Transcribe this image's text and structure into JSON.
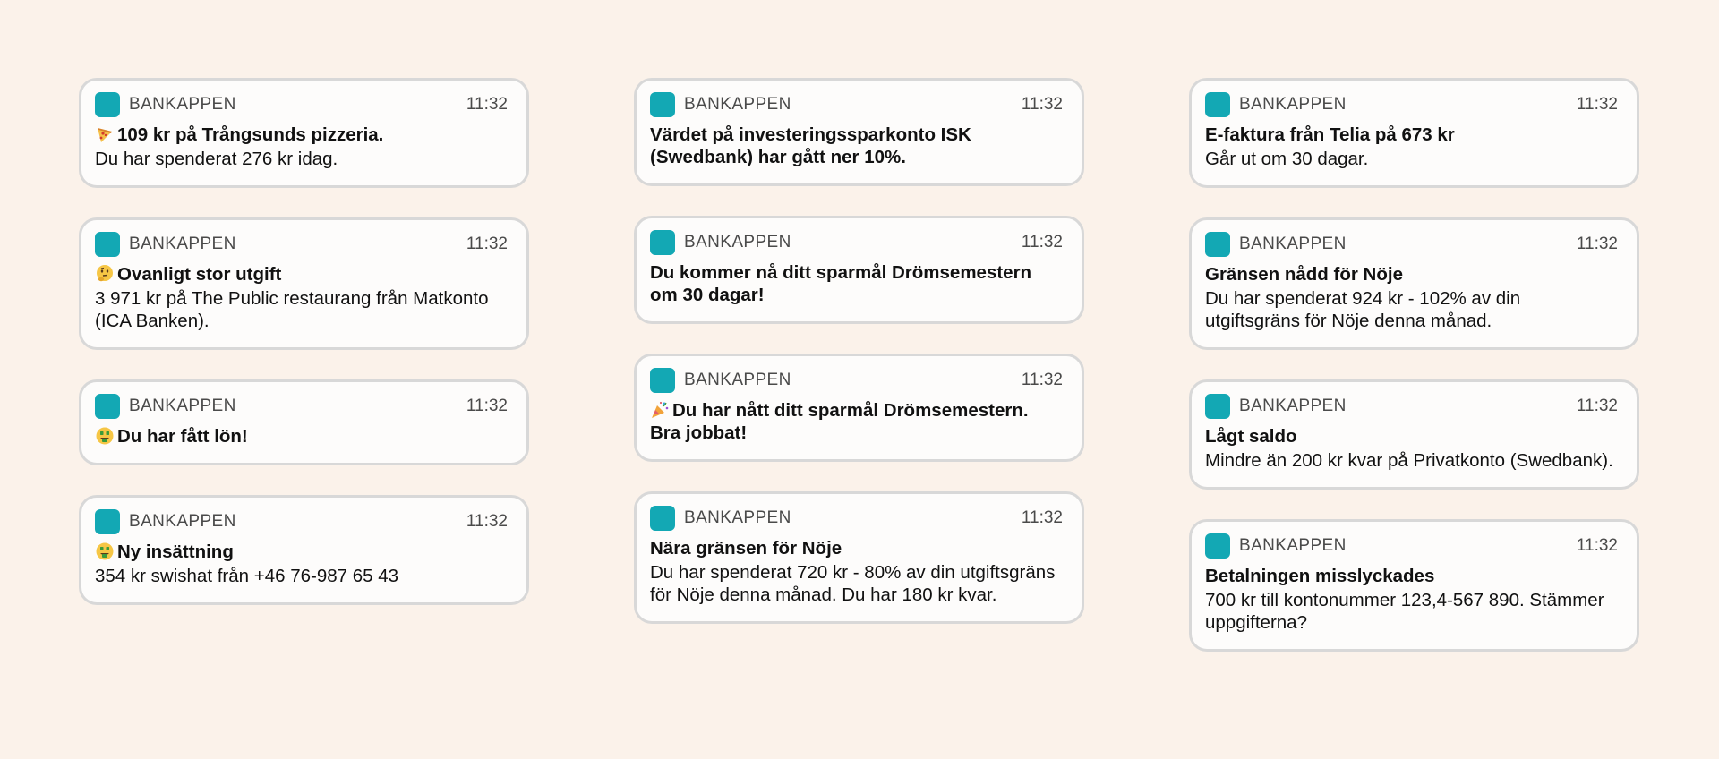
{
  "app_name": "BANKAPPEN",
  "time": "11:32",
  "colors": {
    "background": "#fbf2ea",
    "card": "#fdfcfb",
    "card_border": "#d8d8d8",
    "app_icon": "#13a8b4"
  },
  "columns": [
    [
      {
        "icon": "pizza-emoji",
        "title": "109 kr på Trångsunds pizzeria.",
        "body": "Du har spenderat 276 kr idag."
      },
      {
        "icon": "thinking-face-emoji",
        "title": "Ovanligt stor utgift",
        "body": "3 971 kr på The Public restaurang från Matkonto (ICA Banken)."
      },
      {
        "icon": "money-mouth-face-emoji",
        "title": "Du har fått lön!",
        "body": ""
      },
      {
        "icon": "money-mouth-face-emoji",
        "title": "Ny insättning",
        "body": "354 kr swishat från +46 76-987 65 43"
      }
    ],
    [
      {
        "icon": "",
        "title": "Värdet på investeringssparkonto ISK (Swedbank) har gått ner 10%.",
        "body": ""
      },
      {
        "icon": "",
        "title": "Du kommer nå ditt sparmål Drömsemestern om 30 dagar!",
        "body": ""
      },
      {
        "icon": "party-popper-emoji",
        "title": "Du har nått ditt sparmål Drömsemestern. Bra jobbat!",
        "body": ""
      },
      {
        "icon": "",
        "title": "Nära gränsen för Nöje",
        "body": "Du har spenderat 720 kr - 80% av din utgiftsgräns för Nöje denna månad. Du har 180 kr kvar."
      }
    ],
    [
      {
        "icon": "",
        "title": "E-faktura från Telia på 673 kr",
        "body": "Går ut om 30 dagar."
      },
      {
        "icon": "",
        "title": "Gränsen nådd för Nöje",
        "body": "Du har spenderat 924 kr - 102% av din utgiftsgräns för Nöje denna månad."
      },
      {
        "icon": "",
        "title": "Lågt saldo",
        "body": "Mindre än 200 kr kvar på Privatkonto (Swedbank)."
      },
      {
        "icon": "",
        "title": "Betalningen misslyckades",
        "body": "700 kr till kontonummer 123,4-567 890. Stämmer uppgifterna?"
      }
    ]
  ]
}
